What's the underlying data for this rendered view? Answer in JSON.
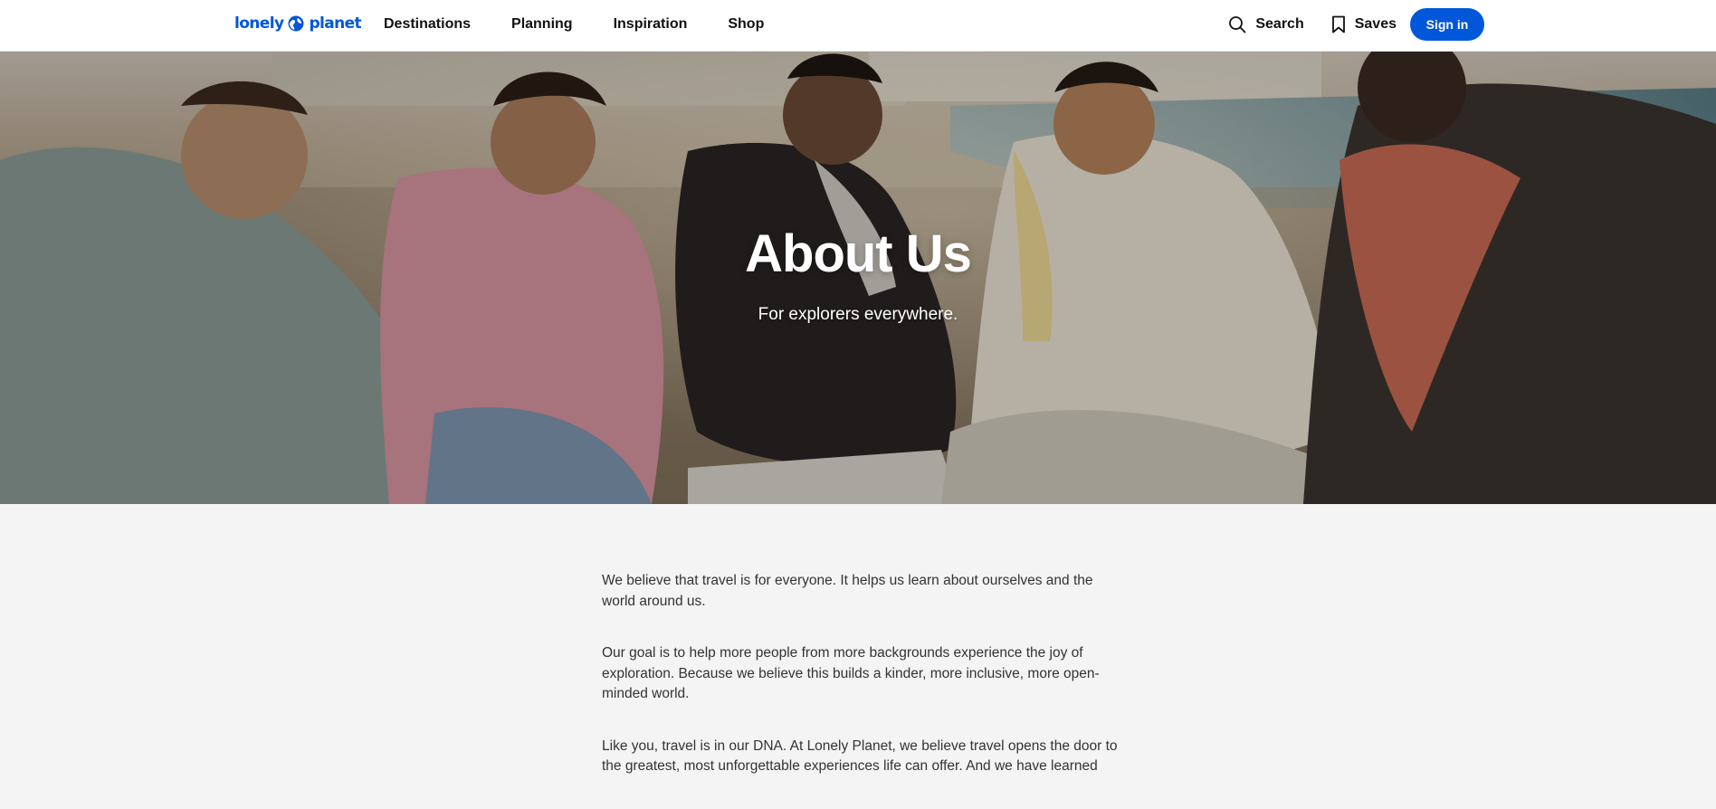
{
  "header": {
    "logo_text_left": "lonely",
    "logo_text_right": "planet",
    "nav": [
      "Destinations",
      "Planning",
      "Inspiration",
      "Shop"
    ],
    "search_label": "Search",
    "saves_label": "Saves",
    "signin_label": "Sign in"
  },
  "hero": {
    "title": "About Us",
    "subtitle": "For explorers everywhere."
  },
  "content": {
    "paragraphs": [
      "We believe that travel is for everyone. It helps us learn about ourselves and the world around us.",
      "Our goal is to help more people from more backgrounds experience the joy of exploration. Because we believe this builds a kinder, more inclusive, more open-minded world.",
      "Like you, travel is in our DNA. At Lonely Planet, we believe travel opens the door to the greatest, most unforgettable experiences life can offer. And we have learned"
    ]
  },
  "colors": {
    "brand_blue": "#0057d9",
    "page_bg": "#f4f4f4"
  }
}
